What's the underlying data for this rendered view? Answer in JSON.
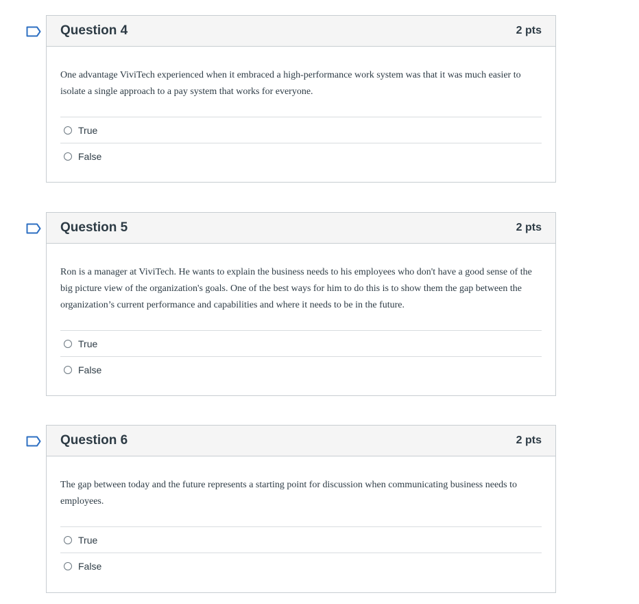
{
  "questions": [
    {
      "title": "Question 4",
      "points": "2 pts",
      "text": "One advantage ViviTech experienced when it embraced a high-performance work system was that it was much easier to isolate a single approach to a pay system that works for everyone.",
      "answers": [
        "True",
        "False"
      ]
    },
    {
      "title": "Question 5",
      "points": "2 pts",
      "text": "Ron is a manager at ViviTech. He wants to explain the business needs to his employees who don't have a good sense of the big picture view of the organization's goals. One of the best ways for him to do this is to show them the gap between the organization’s current performance and capabilities and where it needs to be in the future.",
      "answers": [
        "True",
        "False"
      ]
    },
    {
      "title": "Question 6",
      "points": "2 pts",
      "text": "The gap between today and the future represents a starting point for discussion when communicating business needs to employees.",
      "answers": [
        "True",
        "False"
      ]
    }
  ],
  "icons": {
    "flag": "bookmark-flag-icon",
    "radio": "radio-button-icon"
  },
  "colors": {
    "flag_stroke": "#2d6fc2",
    "header_bg": "#f5f5f5",
    "border": "#c7cdd1",
    "text": "#2d3b45"
  }
}
